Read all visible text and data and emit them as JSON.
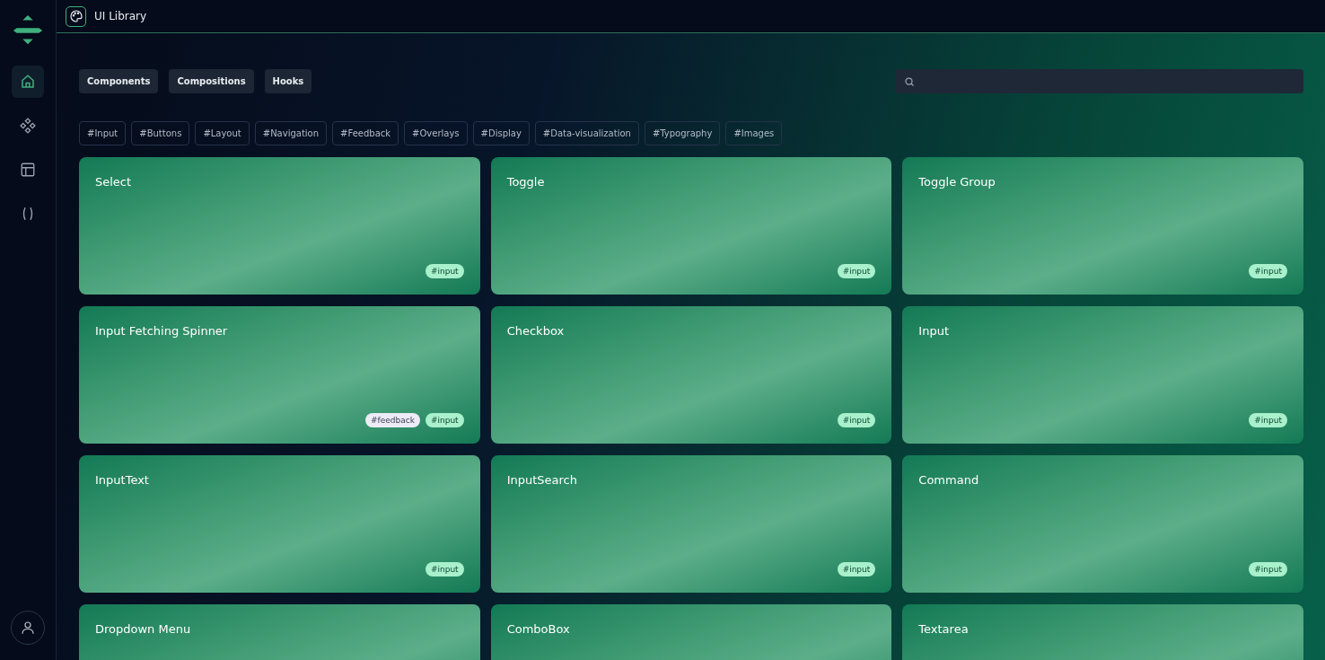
{
  "header": {
    "title": "UI Library"
  },
  "sidebar": {
    "items": [
      {
        "selected": true
      },
      {
        "selected": false
      },
      {
        "selected": false
      },
      {
        "selected": false
      }
    ]
  },
  "tabs": [
    {
      "label": "Components",
      "selected": false
    },
    {
      "label": "Compositions",
      "selected": false
    },
    {
      "label": "Hooks",
      "selected": false
    }
  ],
  "filters": [
    "#Input",
    "#Buttons",
    "#Layout",
    "#Navigation",
    "#Feedback",
    "#Overlays",
    "#Display",
    "#Data-visualization",
    "#Typography",
    "#Images"
  ],
  "cards": [
    {
      "title": "Select",
      "tags": [
        {
          "label": "#input",
          "kind": "input"
        }
      ]
    },
    {
      "title": "Toggle",
      "tags": [
        {
          "label": "#input",
          "kind": "input"
        }
      ]
    },
    {
      "title": "Toggle Group",
      "tags": [
        {
          "label": "#input",
          "kind": "input"
        }
      ]
    },
    {
      "title": "Input Fetching Spinner",
      "tags": [
        {
          "label": "#feedback",
          "kind": "feedback"
        },
        {
          "label": "#input",
          "kind": "input"
        }
      ]
    },
    {
      "title": "Checkbox",
      "tags": [
        {
          "label": "#input",
          "kind": "input"
        }
      ]
    },
    {
      "title": "Input",
      "tags": [
        {
          "label": "#input",
          "kind": "input"
        }
      ]
    },
    {
      "title": "InputText",
      "tags": [
        {
          "label": "#input",
          "kind": "input"
        }
      ]
    },
    {
      "title": "InputSearch",
      "tags": [
        {
          "label": "#input",
          "kind": "input"
        }
      ]
    },
    {
      "title": "Command",
      "tags": [
        {
          "label": "#input",
          "kind": "input"
        }
      ]
    },
    {
      "title": "Dropdown Menu"
    },
    {
      "title": "ComboBox"
    },
    {
      "title": "Textarea"
    }
  ]
}
